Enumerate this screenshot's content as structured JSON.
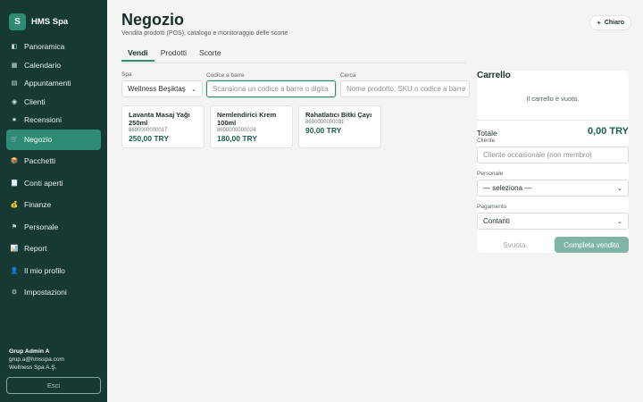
{
  "brand": {
    "logo_letter": "S",
    "name": "HMS Spa"
  },
  "sidebar": {
    "items": [
      {
        "icon": "◧",
        "label": "Panoramica"
      },
      {
        "icon": "▦",
        "label": "Calendario"
      },
      {
        "icon": "▤",
        "label": "Appuntamenti"
      },
      {
        "icon": "◉",
        "label": "Clienti"
      },
      {
        "icon": "★",
        "label": "Recensioni"
      },
      {
        "icon": "🛒",
        "label": "Negozio"
      },
      {
        "icon": "📦",
        "label": "Pacchetti"
      },
      {
        "icon": "🧾",
        "label": "Conti aperti"
      },
      {
        "icon": "💰",
        "label": "Finanze"
      },
      {
        "icon": "⚑",
        "label": "Personale"
      },
      {
        "icon": "📊",
        "label": "Report"
      },
      {
        "icon": "👤",
        "label": "Il mio profilo"
      },
      {
        "icon": "⚙",
        "label": "Impostazioni"
      }
    ],
    "active": "Negozio"
  },
  "user": {
    "name": "Grup Admin A",
    "email": "grup.a@hmsspa.com",
    "company": "Wellness Spa A.Ş.",
    "logout_label": "Esci"
  },
  "header": {
    "title": "Negozio",
    "subtitle": "Vendita prodotti (POS), catalogo e monitoraggio delle scorte",
    "theme_icon": "☀",
    "theme_label": "Chiaro"
  },
  "tabs": [
    "Vendi",
    "Prodotti",
    "Scorte"
  ],
  "filters": {
    "spa_label": "Spa",
    "spa_value": "Wellness Beşiktaş",
    "barcode_label": "Codice a barre",
    "barcode_placeholder": "Scansiona un codice a barre o digita",
    "search_label": "Cerca",
    "search_placeholder": "Nome prodotto, SKU o codice a barre"
  },
  "products": [
    {
      "name": "Lavanta Masaj Yağı 250ml",
      "sku": "8690000000017",
      "price": "250,00 TRY"
    },
    {
      "name": "Nemlendirici Krem 100ml",
      "sku": "8690000000024",
      "price": "180,00 TRY"
    },
    {
      "name": "Rahatlatıcı Bitki Çayı",
      "sku": "8690000000031",
      "price": "90,00 TRY"
    }
  ],
  "cart": {
    "title": "Carrello",
    "empty_text": "Il carrello è vuoto.",
    "total_label": "Totale",
    "total_value": "0,00 TRY",
    "client_label": "Cliente",
    "client_placeholder": "Cliente occasionale (non membro)",
    "staff_label": "Personale",
    "staff_value": "— seleziona —",
    "payment_label": "Pagamento",
    "payment_value": "Contanti",
    "clear_label": "Svuota",
    "complete_label": "Completa vendita"
  },
  "colors": {
    "sidebar_bg": "#163a33",
    "accent": "#2e8b74",
    "price": "#1a5e4f"
  }
}
